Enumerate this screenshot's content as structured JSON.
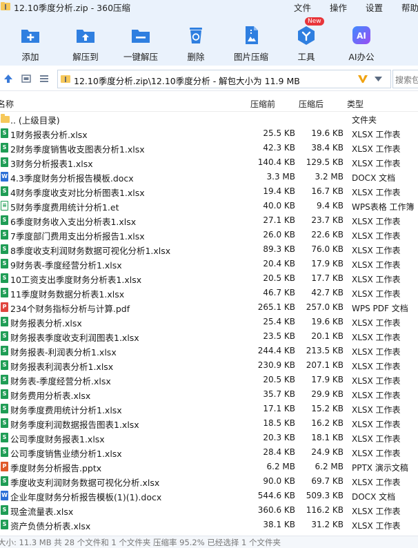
{
  "window": {
    "title": "12.10季度分析.zip - 360压缩"
  },
  "menu": [
    "文件",
    "操作",
    "设置",
    "帮助"
  ],
  "toolbar": [
    {
      "label": "添加",
      "icon": "add-icon",
      "color": "#2f7fe0"
    },
    {
      "label": "解压到",
      "icon": "extract-icon",
      "color": "#2f7fe0"
    },
    {
      "label": "一键解压",
      "icon": "one-click-extract-icon",
      "color": "#2f7fe0"
    },
    {
      "label": "删除",
      "icon": "recycle-delete-icon",
      "color": "#2f7fe0"
    },
    {
      "label": "图片压缩",
      "icon": "image-compress-icon",
      "color": "#2f7fe0"
    },
    {
      "label": "工具",
      "icon": "tools-icon",
      "color": "#2f7fe0",
      "badge": "New"
    },
    {
      "label": "AI办公",
      "icon": "ai-office-icon",
      "color": "#7a4cf2"
    }
  ],
  "address": {
    "path": "12.10季度分析.zip\\12.10季度分析 - 解包大小为 11.9 MB",
    "search_placeholder": "搜索包"
  },
  "columns": {
    "name": "名称",
    "compressed_before": "压缩前",
    "compressed_after": "压缩后",
    "type": "类型"
  },
  "files": [
    {
      "name": ".. (上级目录)",
      "before": "",
      "after": "",
      "type": "文件夹",
      "icon": "folder-up-icon"
    },
    {
      "name": "1财务报表分析.xlsx",
      "before": "25.5 KB",
      "after": "19.6 KB",
      "type": "XLSX 工作表",
      "icon": "xlsx-icon"
    },
    {
      "name": "2财务季度销售收支图表分析1.xlsx",
      "before": "42.3 KB",
      "after": "38.4 KB",
      "type": "XLSX 工作表",
      "icon": "xlsx-icon"
    },
    {
      "name": "3财务分析报表1.xlsx",
      "before": "140.4 KB",
      "after": "129.5 KB",
      "type": "XLSX 工作表",
      "icon": "xlsx-icon"
    },
    {
      "name": "4.3季度财务分析报告模板.docx",
      "before": "3.3 MB",
      "after": "3.2 MB",
      "type": "DOCX 文档",
      "icon": "docx-icon"
    },
    {
      "name": "4财务季度收支对比分析图表1.xlsx",
      "before": "19.4 KB",
      "after": "16.7 KB",
      "type": "XLSX 工作表",
      "icon": "xlsx-icon"
    },
    {
      "name": "5财务季度费用统计分析1.et",
      "before": "40.0 KB",
      "after": "9.4 KB",
      "type": "WPS表格 工作簿",
      "icon": "et-icon"
    },
    {
      "name": "6季度财务收入支出分析表1.xlsx",
      "before": "27.1 KB",
      "after": "23.7 KB",
      "type": "XLSX 工作表",
      "icon": "xlsx-icon"
    },
    {
      "name": "7季度部门费用支出分析报告1.xlsx",
      "before": "26.0 KB",
      "after": "22.6 KB",
      "type": "XLSX 工作表",
      "icon": "xlsx-icon"
    },
    {
      "name": "8季度收支利润财务数据可视化分析1.xlsx",
      "before": "89.3 KB",
      "after": "76.0 KB",
      "type": "XLSX 工作表",
      "icon": "xlsx-icon"
    },
    {
      "name": "9财务表-季度经营分析1.xlsx",
      "before": "20.4 KB",
      "after": "17.9 KB",
      "type": "XLSX 工作表",
      "icon": "xlsx-icon"
    },
    {
      "name": "10工资支出季度财务分析表1.xlsx",
      "before": "20.5 KB",
      "after": "17.7 KB",
      "type": "XLSX 工作表",
      "icon": "xlsx-icon"
    },
    {
      "name": "11季度财务数据分析表1.xlsx",
      "before": "46.7 KB",
      "after": "42.7 KB",
      "type": "XLSX 工作表",
      "icon": "xlsx-icon"
    },
    {
      "name": "234个财务指标分析与计算.pdf",
      "before": "265.1 KB",
      "after": "257.0 KB",
      "type": "WPS PDF 文档",
      "icon": "pdf-icon"
    },
    {
      "name": "财务报表分析.xlsx",
      "before": "25.4 KB",
      "after": "19.6 KB",
      "type": "XLSX 工作表",
      "icon": "xlsx-icon"
    },
    {
      "name": "财务报表季度收支利润图表1.xlsx",
      "before": "23.5 KB",
      "after": "20.1 KB",
      "type": "XLSX 工作表",
      "icon": "xlsx-icon"
    },
    {
      "name": "财务报表-利润表分析1.xlsx",
      "before": "244.4 KB",
      "after": "213.5 KB",
      "type": "XLSX 工作表",
      "icon": "xlsx-icon"
    },
    {
      "name": "财务报表利润表分析1.xlsx",
      "before": "230.9 KB",
      "after": "207.1 KB",
      "type": "XLSX 工作表",
      "icon": "xlsx-icon"
    },
    {
      "name": "财务表-季度经营分析.xlsx",
      "before": "20.5 KB",
      "after": "17.9 KB",
      "type": "XLSX 工作表",
      "icon": "xlsx-icon"
    },
    {
      "name": "财务费用分析表.xlsx",
      "before": "35.7 KB",
      "after": "29.9 KB",
      "type": "XLSX 工作表",
      "icon": "xlsx-icon"
    },
    {
      "name": "财务季度费用统计分析1.xlsx",
      "before": "17.1 KB",
      "after": "15.2 KB",
      "type": "XLSX 工作表",
      "icon": "xlsx-icon"
    },
    {
      "name": "财务季度利润数据报告图表1.xlsx",
      "before": "18.5 KB",
      "after": "16.2 KB",
      "type": "XLSX 工作表",
      "icon": "xlsx-icon"
    },
    {
      "name": "公司季度财务报表1.xlsx",
      "before": "20.3 KB",
      "after": "18.1 KB",
      "type": "XLSX 工作表",
      "icon": "xlsx-icon"
    },
    {
      "name": "公司季度销售业绩分析1.xlsx",
      "before": "28.4 KB",
      "after": "24.9 KB",
      "type": "XLSX 工作表",
      "icon": "xlsx-icon"
    },
    {
      "name": "季度财务分析报告.pptx",
      "before": "6.2 MB",
      "after": "6.2 MB",
      "type": "PPTX 演示文稿",
      "icon": "pptx-icon"
    },
    {
      "name": "季度收支利润财务数据可视化分析.xlsx",
      "before": "90.0 KB",
      "after": "69.7 KB",
      "type": "XLSX 工作表",
      "icon": "xlsx-icon"
    },
    {
      "name": "企业年度财务分析报告模板(1)(1).docx",
      "before": "544.6 KB",
      "after": "509.3 KB",
      "type": "DOCX 文档",
      "icon": "docx-icon"
    },
    {
      "name": "现金流量表.xlsx",
      "before": "360.6 KB",
      "after": "116.2 KB",
      "type": "XLSX 工作表",
      "icon": "xlsx-icon"
    },
    {
      "name": "资产负债分析表.xlsx",
      "before": "38.1 KB",
      "after": "31.2 KB",
      "type": "XLSX 工作表",
      "icon": "xlsx-icon"
    }
  ],
  "status": "大小: 11.3 MB 共 28 个文件和 1 个文件夹 压缩率 95.2% 已经选择 1 个文件夹",
  "colors": {
    "xlsx": "#1f9d55",
    "docx": "#2b6fd6",
    "pdf": "#e0443e",
    "pptx": "#e0592a",
    "et": "#1f9d55",
    "folder": "#f6c85a"
  }
}
